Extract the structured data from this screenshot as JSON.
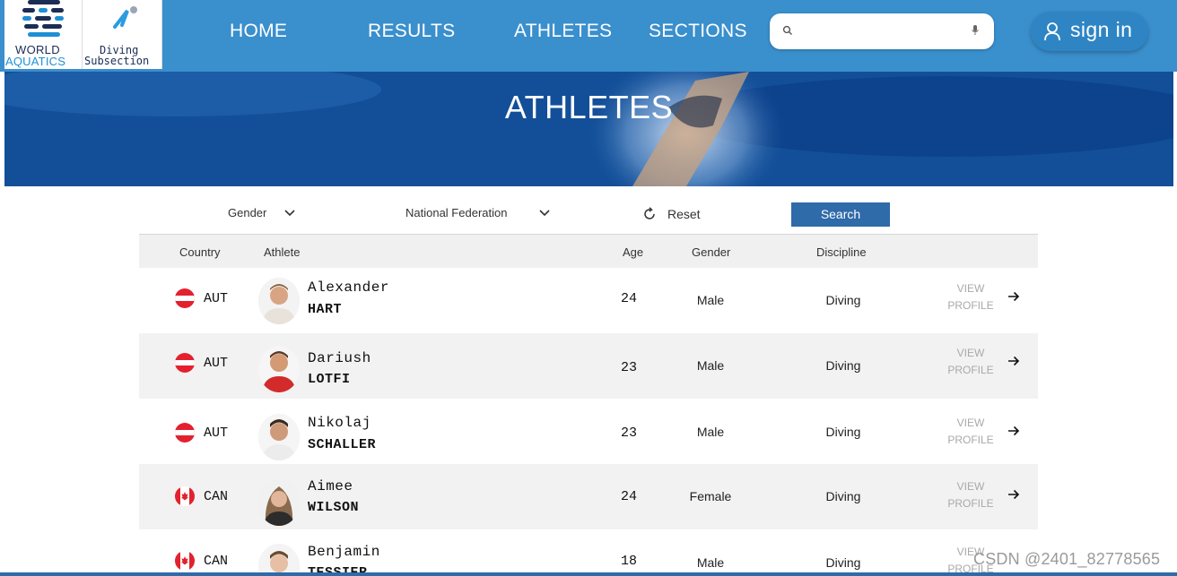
{
  "header": {
    "logo_left_line1": "WORLD",
    "logo_left_line2": "AQUATICS",
    "logo_right_line1": "Diving",
    "logo_right_line2": "Subsection",
    "nav": [
      "HOME",
      "RESULTS",
      "ATHLETES",
      "SECTIONS"
    ],
    "search_placeholder": "",
    "signin_label": "sign in"
  },
  "hero": {
    "title": "ATHLETES"
  },
  "filters": {
    "gender_label": "Gender",
    "federation_label": "National Federation",
    "reset_label": "Reset",
    "search_label": "Search"
  },
  "table": {
    "headers": {
      "country": "Country",
      "athlete": "Athlete",
      "age": "Age",
      "gender": "Gender",
      "discipline": "Discipline"
    },
    "view_line1": "VIEW",
    "view_line2": "PROFILE",
    "rows": [
      {
        "country": "AUT",
        "first": "Alexander",
        "last": "HART",
        "age": "24",
        "gender": "Male",
        "discipline": "Diving"
      },
      {
        "country": "AUT",
        "first": "Dariush",
        "last": "LOTFI",
        "age": "23",
        "gender": "Male",
        "discipline": "Diving"
      },
      {
        "country": "AUT",
        "first": "Nikolaj",
        "last": "SCHALLER",
        "age": "23",
        "gender": "Male",
        "discipline": "Diving"
      },
      {
        "country": "CAN",
        "first": "Aimee",
        "last": "WILSON",
        "age": "24",
        "gender": "Female",
        "discipline": "Diving"
      },
      {
        "country": "CAN",
        "first": "Benjamin",
        "last": "TESSIER",
        "age": "18",
        "gender": "Male",
        "discipline": "Diving"
      }
    ]
  },
  "watermark": "CSDN @2401_82778565",
  "colors": {
    "header_bg": "#3a8fcd",
    "search_button": "#2f6aa9",
    "row_alt": "#f2f2f2"
  },
  "icons": [
    "search-icon",
    "mic-icon",
    "user-icon",
    "chevron-down-icon",
    "refresh-icon",
    "arrow-right-icon",
    "flag-austria-icon",
    "flag-canada-icon"
  ]
}
